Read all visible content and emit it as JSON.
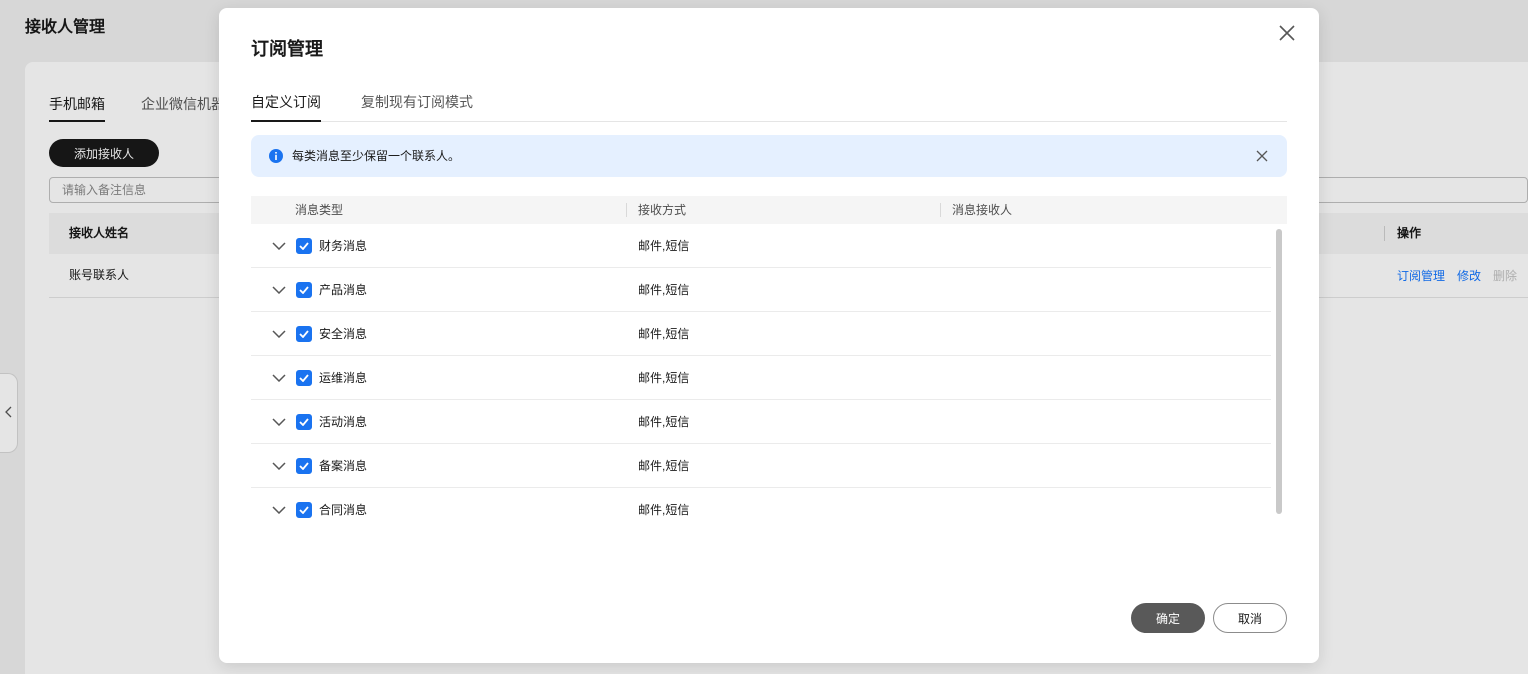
{
  "background": {
    "page_title": "接收人管理",
    "tabs": [
      {
        "label": "手机邮箱",
        "active": true
      },
      {
        "label": "企业微信机器",
        "active": false
      }
    ],
    "add_button_label": "添加接收人",
    "search": {
      "placeholder": "请输入备注信息",
      "value": ""
    },
    "table": {
      "columns": [
        "接收人姓名",
        "操作"
      ],
      "rows": [
        {
          "name": "账号联系人",
          "actions": [
            {
              "label": "订阅管理",
              "disabled": false
            },
            {
              "label": "修改",
              "disabled": false
            },
            {
              "label": "删除",
              "disabled": true
            }
          ]
        }
      ]
    },
    "side_handle_icon": "chevron-left-icon"
  },
  "modal": {
    "title": "订阅管理",
    "close_icon": "close-icon",
    "tabs": [
      {
        "label": "自定义订阅",
        "active": true
      },
      {
        "label": "复制现有订阅模式",
        "active": false
      }
    ],
    "alert": {
      "icon": "info-icon",
      "text": "每类消息至少保留一个联系人。",
      "close_icon": "close-icon"
    },
    "table": {
      "columns": [
        "消息类型",
        "接收方式",
        "消息接收人"
      ],
      "expand_icon": "chevron-down-icon",
      "rows": [
        {
          "type": "财务消息",
          "checked": true,
          "methods": "邮件,短信"
        },
        {
          "type": "产品消息",
          "checked": true,
          "methods": "邮件,短信"
        },
        {
          "type": "安全消息",
          "checked": true,
          "methods": "邮件,短信"
        },
        {
          "type": "运维消息",
          "checked": true,
          "methods": "邮件,短信"
        },
        {
          "type": "活动消息",
          "checked": true,
          "methods": "邮件,短信"
        },
        {
          "type": "备案消息",
          "checked": true,
          "methods": "邮件,短信"
        },
        {
          "type": "合同消息",
          "checked": true,
          "methods": "邮件,短信"
        }
      ]
    },
    "buttons": {
      "confirm": "确定",
      "cancel": "取消"
    }
  },
  "colors": {
    "accent": "#1a73f0",
    "link": "#1476ff",
    "alert_bg": "#e5f0ff",
    "confirm_bg": "#595959",
    "disabled": "#c2c2c2"
  }
}
